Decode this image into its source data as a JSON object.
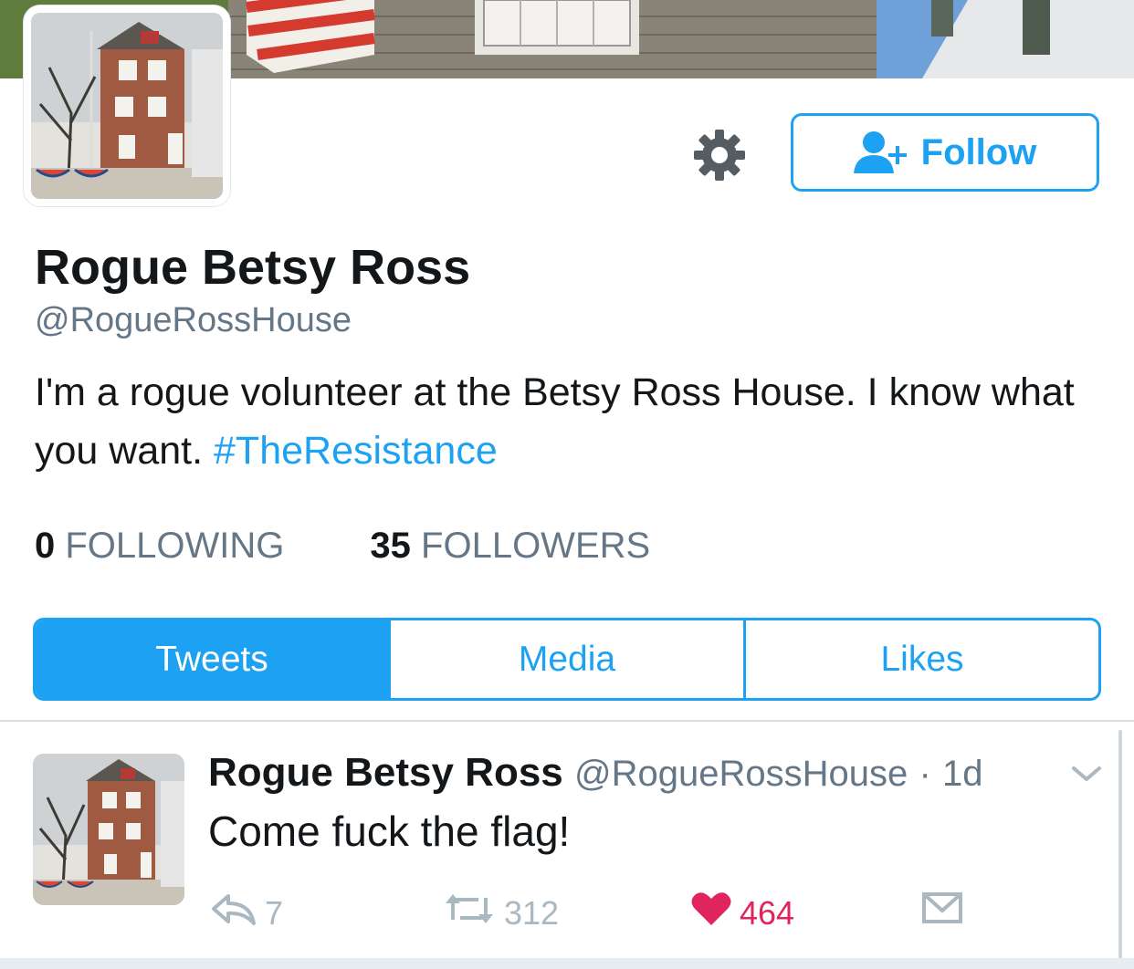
{
  "profile": {
    "name": "Rogue Betsy Ross",
    "handle": "@RogueRossHouse",
    "bio_text": "I'm a rogue volunteer at the Betsy Ross House. I know what you want.",
    "bio_hashtag": "#TheResistance",
    "following_count": "0",
    "following_label": "FOLLOWING",
    "followers_count": "35",
    "followers_label": "FOLLOWERS"
  },
  "actions": {
    "follow_label": "Follow",
    "settings_icon": "gear-icon",
    "follow_icon": "add-user-icon"
  },
  "tabs": [
    {
      "label": "Tweets",
      "active": true
    },
    {
      "label": "Media",
      "active": false
    },
    {
      "label": "Likes",
      "active": false
    }
  ],
  "tweet": {
    "name": "Rogue Betsy Ross",
    "handle": "@RogueRossHouse",
    "separator": "·",
    "time": "1d",
    "text": "Come fuck the flag!",
    "reply_count": "7",
    "retweet_count": "312",
    "like_count": "464"
  },
  "colors": {
    "accent": "#1da1f2",
    "like": "#e0245e",
    "secondary_text": "#657786"
  }
}
